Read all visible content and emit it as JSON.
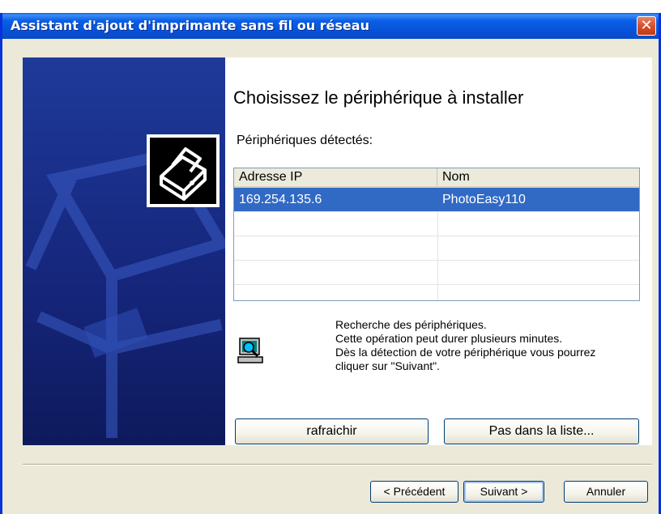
{
  "window": {
    "title": "Assistant d'ajout d'imprimante sans fil ou réseau",
    "close_symbol": "✕"
  },
  "content": {
    "heading": "Choisissez le périphérique à installer",
    "detected_label": "Périphériques détectés:"
  },
  "device_list": {
    "columns": [
      "Adresse IP",
      "Nom"
    ],
    "rows": [
      {
        "ip": "169.254.135.6",
        "name": "PhotoEasy110",
        "selected": true
      }
    ]
  },
  "search_status": {
    "icon": "computer-search-icon",
    "lines": [
      "Recherche des périphériques.",
      "Cette opération peut durer plusieurs minutes.",
      "Dès la détection de votre périphérique vous pourrez",
      "cliquer sur \"Suivant\"."
    ]
  },
  "buttons": {
    "refresh": "rafraichir",
    "not_in_list": "Pas dans la liste...",
    "previous": "< Précédent",
    "next": "Suivant >",
    "cancel": "Annuler"
  },
  "colors": {
    "titlebar": "#0a5fe6",
    "selection": "#316ac5",
    "side_panel": "#15257a"
  }
}
